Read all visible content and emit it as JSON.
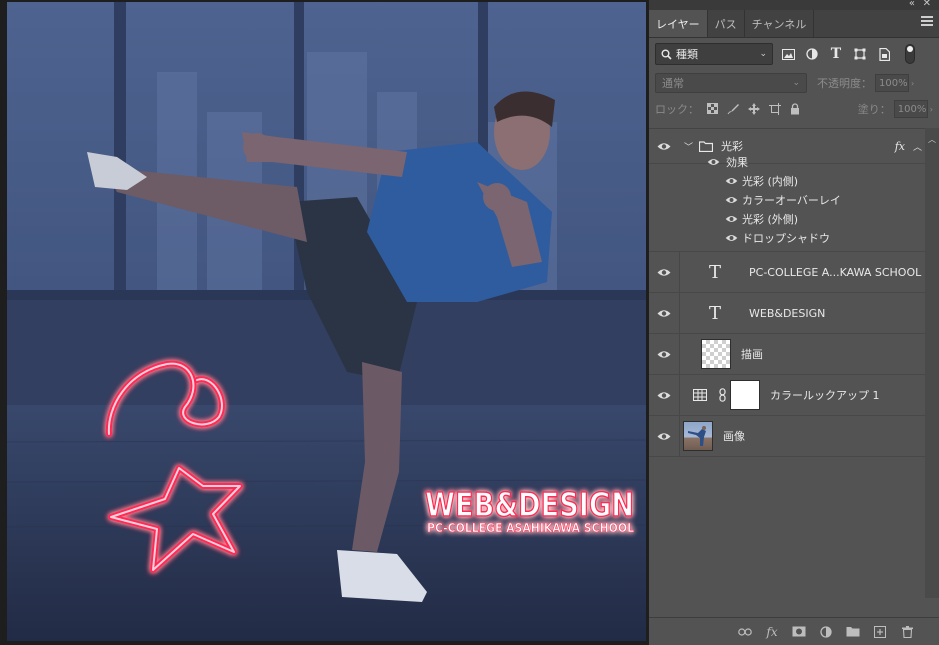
{
  "tabs": [
    {
      "label": "レイヤー",
      "active": true
    },
    {
      "label": "パス",
      "active": false
    },
    {
      "label": "チャンネル",
      "active": false
    }
  ],
  "filter": {
    "label": "種類"
  },
  "blend": {
    "mode": "通常",
    "opacity_label": "不透明度：",
    "opacity_value": "100%"
  },
  "lock": {
    "label": "ロック：",
    "fill_label": "塗り：",
    "fill_value": "100%"
  },
  "layers": {
    "group": {
      "name": "光彩",
      "fx": "fx"
    },
    "effects_label": "効果",
    "effects": [
      "光彩 (内側)",
      "カラーオーバーレイ",
      "光彩 (外側)",
      "ドロップシャドウ"
    ],
    "text1": "PC-COLLEGE A...KAWA SCHOOL",
    "text2": "WEB&DESIGN",
    "draw": "描画",
    "lookup": "カラールックアップ  1",
    "image": "画像"
  },
  "artwork": {
    "headline": "WEB&DESIGN",
    "subline": "PC-COLLEGE ASAHIKAWA SCHOOL",
    "neon_color": "#ff2a55",
    "background_color": "#3b4e78"
  },
  "colors": {
    "panel_bg": "#535353",
    "tab_bg": "#424242",
    "canvas_bg": "#1e1e1e"
  }
}
